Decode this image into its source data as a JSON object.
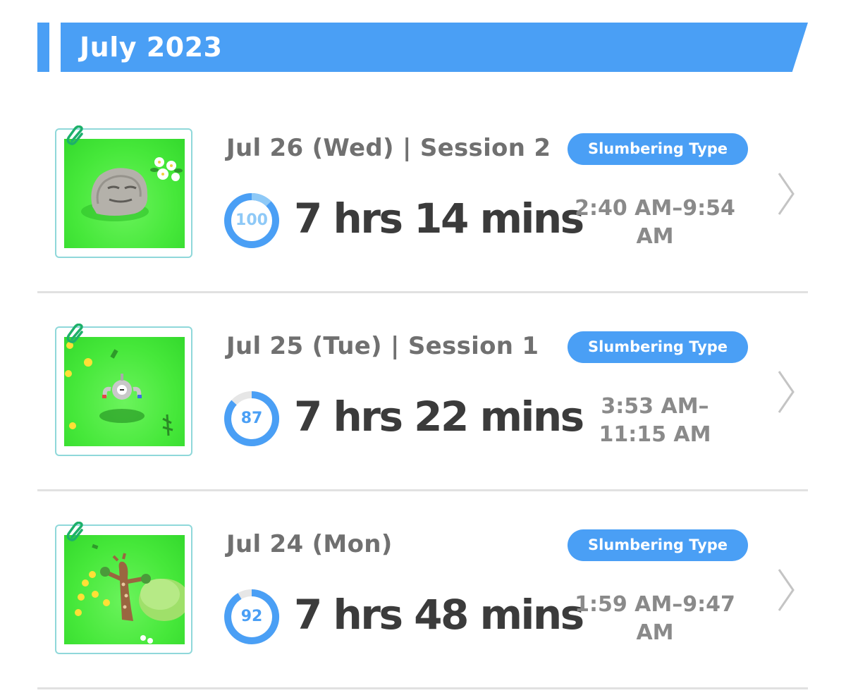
{
  "month": {
    "title": "July 2023"
  },
  "entries": [
    {
      "date": "Jul 26 (Wed) | Session 2",
      "type": "Slumbering Type",
      "score": "100",
      "score_fraction": 1.0,
      "duration": "7 hrs 14 mins",
      "time_range": "2:40 AM–9:54 AM",
      "scene": "sleeping-rock-pokemon"
    },
    {
      "date": "Jul 25 (Tue) | Session 1",
      "type": "Slumbering Type",
      "score": "87",
      "score_fraction": 0.87,
      "duration": "7 hrs 22 mins",
      "time_range": "3:53 AM–11:15 AM",
      "scene": "magnet-pokemon"
    },
    {
      "date": "Jul 24 (Mon)",
      "type": "Slumbering Type",
      "score": "92",
      "score_fraction": 0.92,
      "duration": "7 hrs 48 mins",
      "time_range": "1:59 AM–9:47 AM",
      "scene": "tree-pokemon"
    }
  ],
  "colors": {
    "accent_blue": "#4a9ff5",
    "score_light": "#8ec9f7",
    "score_track": "#e6e6e6",
    "thumb_border": "#8fd8da",
    "clip_green": "#1db06a"
  },
  "icons": {
    "attach": "paperclip-icon",
    "open": "chevron-right-icon"
  }
}
